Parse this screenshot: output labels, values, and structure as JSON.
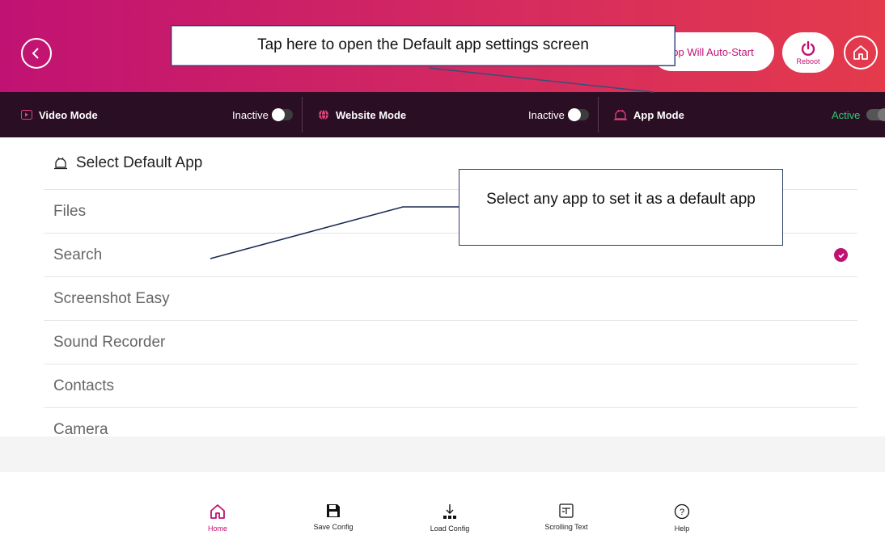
{
  "header": {
    "autostart_label": "pp Will Auto-Start",
    "reboot_label": "Reboot"
  },
  "modes": [
    {
      "name": "Video Mode",
      "status": "Inactive",
      "icon": "play-icon"
    },
    {
      "name": "Website Mode",
      "status": "Inactive",
      "icon": "globe-icon"
    },
    {
      "name": "App Mode",
      "status": "Active",
      "icon": "app-bell-icon"
    }
  ],
  "panel": {
    "title": "Select Default App",
    "apps": [
      {
        "label": "Files",
        "selected": false
      },
      {
        "label": "Search",
        "selected": true
      },
      {
        "label": "Screenshot Easy",
        "selected": false
      },
      {
        "label": "Sound Recorder",
        "selected": false
      },
      {
        "label": "Contacts",
        "selected": false
      },
      {
        "label": "Camera",
        "selected": false
      }
    ]
  },
  "bottom_nav": [
    {
      "label": "Home",
      "icon": "home-icon",
      "active": true
    },
    {
      "label": "Save Config",
      "icon": "save-icon",
      "active": false
    },
    {
      "label": "Load Config",
      "icon": "download-icon",
      "active": false
    },
    {
      "label": "Scrolling Text",
      "icon": "scrolling-text-icon",
      "active": false
    },
    {
      "label": "Help",
      "icon": "help-icon",
      "active": false
    }
  ],
  "callouts": {
    "top": "Tap here to open the Default app settings screen",
    "middle": "Select any app to set it as a default app"
  },
  "colors": {
    "brand": "#c01272",
    "mode_bar": "#2a0e24",
    "active_status": "#2ecc71"
  }
}
